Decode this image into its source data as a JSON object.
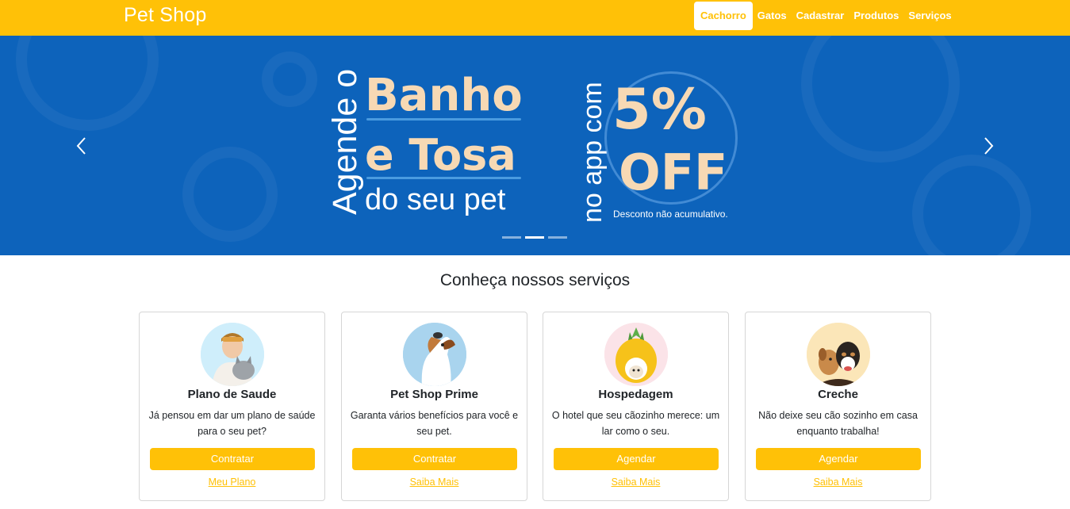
{
  "navbar": {
    "brand": "Pet Shop",
    "links": [
      {
        "label": "Cachorro",
        "active": true
      },
      {
        "label": "Gatos",
        "active": false
      },
      {
        "label": "Cadastrar",
        "active": false
      },
      {
        "label": "Produtos",
        "active": false
      },
      {
        "label": "Serviços",
        "active": false
      }
    ]
  },
  "carousel": {
    "slide": {
      "vertical_left": "Agende o",
      "headline_1": "Banho",
      "headline_2": "e Tosa",
      "headline_3": "do seu pet",
      "vertical_right": "no app com",
      "discount_1": "5%",
      "discount_2": "OFF",
      "disclaimer": "Desconto não acumulativo."
    },
    "slide_count": 3,
    "active_index": 1,
    "colors": {
      "background": "#0d63bb",
      "accent": "#f7d9b4"
    }
  },
  "section": {
    "title": "Conheça nossos serviços"
  },
  "cards": [
    {
      "title": "Plano de Saude",
      "text": "Já pensou em dar um plano de saúde para o seu pet?",
      "button": "Contratar",
      "link": "Meu Plano",
      "image": "woman-with-cat"
    },
    {
      "title": "Pet Shop Prime",
      "text": "Garanta vários benefícios para você e seu pet.",
      "button": "Contratar",
      "link": "Saiba Mais",
      "image": "dog-looking-up"
    },
    {
      "title": "Hospedagem",
      "text": "O hotel que seu cãozinho merece: um lar como o seu.",
      "button": "Agendar",
      "link": "Saiba Mais",
      "image": "dog-in-pineapple-bed"
    },
    {
      "title": "Creche",
      "text": "Não deixe seu cão sozinho em casa enquanto trabalha!",
      "button": "Agendar",
      "link": "Saiba Mais",
      "image": "two-dogs"
    }
  ],
  "theme": {
    "primary": "#ffc107",
    "text": "#212529"
  }
}
